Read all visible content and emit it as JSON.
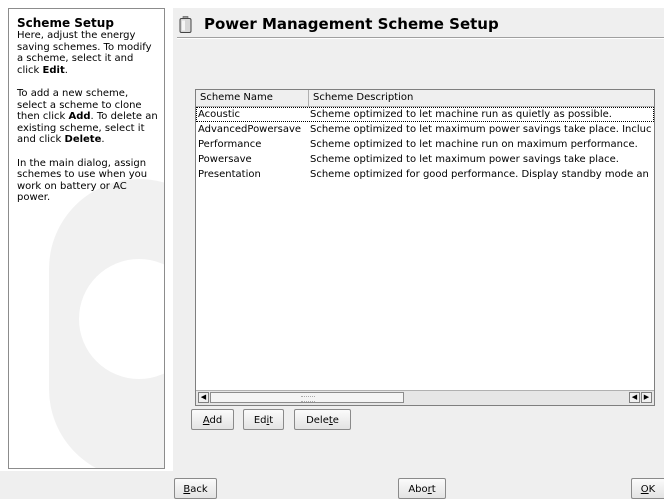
{
  "help": {
    "title": "Scheme Setup",
    "para1_text": "Here, adjust the energy saving schemes. To modify a scheme, select it and click ",
    "para1_bold": "Edit",
    "para1_end": ".",
    "para2_a": "To add a new scheme, select a scheme to clone then click ",
    "para2_add": "Add",
    "para2_b": ". To delete an existing scheme, select it and click ",
    "para2_delete": "Delete",
    "para2_end": ".",
    "para3": "In the main dialog, assign schemes to use when you work on battery or AC power."
  },
  "dialog": {
    "title": "Power Management Scheme Setup",
    "icon": "battery-icon"
  },
  "table": {
    "headers": {
      "name": "Scheme Name",
      "description": "Scheme Description"
    },
    "rows": [
      {
        "name": "Acoustic",
        "description": "Scheme optimized to let machine run as quietly as possible."
      },
      {
        "name": "AdvancedPowersave",
        "description": "Scheme optimized to let maximum power savings take place. Incluc"
      },
      {
        "name": "Performance",
        "description": "Scheme optimized to let machine run on maximum performance."
      },
      {
        "name": "Powersave",
        "description": "Scheme optimized to let maximum power savings take place."
      },
      {
        "name": "Presentation",
        "description": "Scheme optimized for good performance. Display standby mode an"
      }
    ]
  },
  "buttons": {
    "add_pre": "",
    "add_key": "A",
    "add_post": "dd",
    "edit_pre": "Ed",
    "edit_key": "i",
    "edit_post": "t",
    "delete_pre": "Dele",
    "delete_key": "t",
    "delete_post": "e",
    "back_pre": "",
    "back_key": "B",
    "back_post": "ack",
    "abort_pre": "Abo",
    "abort_key": "r",
    "abort_post": "t",
    "ok_pre": "",
    "ok_key": "O",
    "ok_post": "K"
  }
}
